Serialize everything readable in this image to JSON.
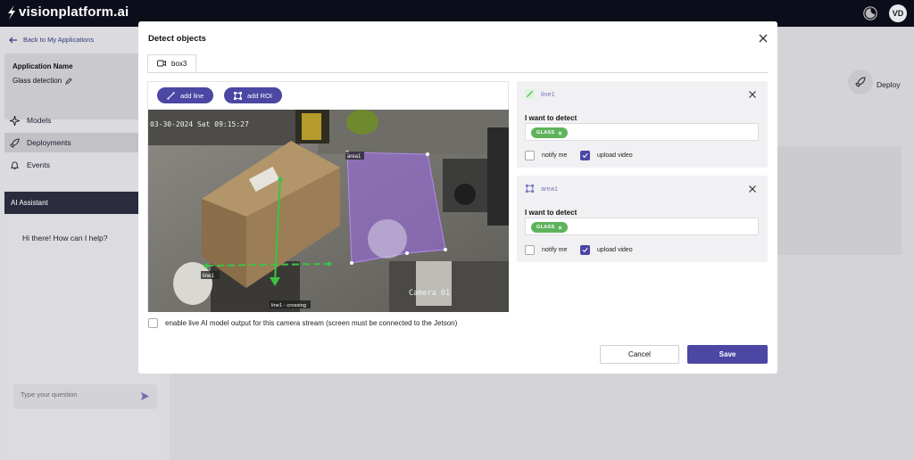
{
  "brand": {
    "name": "visionplatform.ai"
  },
  "user": {
    "initials": "VD"
  },
  "sidebar": {
    "back_label": "Back to My Applications",
    "app_name_label": "Application Name",
    "app_name": "Glass detection",
    "items": [
      {
        "label": "Models",
        "icon": "sparkle-icon"
      },
      {
        "label": "Deployments",
        "icon": "rocket-icon",
        "active": true
      },
      {
        "label": "Events",
        "icon": "bell-icon"
      }
    ],
    "ai": {
      "title": "AI Assistant",
      "greeting": "Hi there! How can I help?",
      "placeholder": "Type your question"
    }
  },
  "content": {
    "deploy_label": "Deploy"
  },
  "modal": {
    "title": "Detect objects",
    "tab": "box3",
    "add_line_label": "add line",
    "add_roi_label": "add ROI",
    "camera": {
      "timestamp": "03-30-2024 Sat 09:15:27",
      "camera_name": "Camera 01",
      "zone_label": "area1",
      "line_label": "line1",
      "crossing_label": "line1 - crossing"
    },
    "live_output_label": "enable live AI model output for this camera stream (screen must be connected to the Jetson)",
    "live_output_checked": false,
    "rules": [
      {
        "name": "line1",
        "icon": "line-tool-icon",
        "detect_label": "I want to detect",
        "tag": "GLASS",
        "notify_label": "notify me",
        "notify_checked": false,
        "upload_label": "upload video",
        "upload_checked": true
      },
      {
        "name": "area1",
        "icon": "roi-tool-icon",
        "detect_label": "I want to detect",
        "tag": "GLASS",
        "notify_label": "notify me",
        "notify_checked": false,
        "upload_label": "upload video",
        "upload_checked": true
      }
    ],
    "cancel_label": "Cancel",
    "save_label": "Save"
  },
  "colors": {
    "accent": "#4b47a3",
    "tag_green": "#5fb35c",
    "line_green": "#3cc247",
    "roi_purple": "#9a6ae0"
  }
}
